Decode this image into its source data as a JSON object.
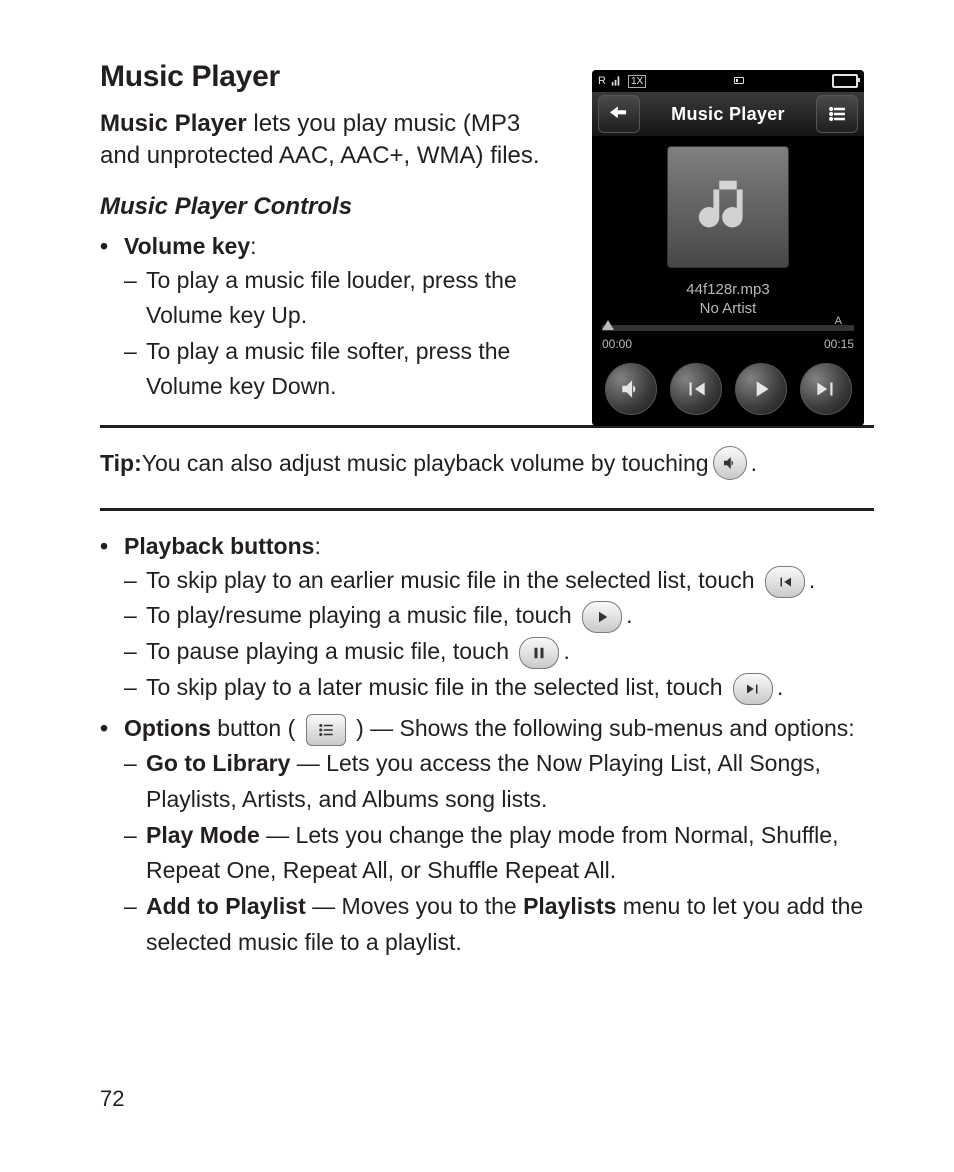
{
  "heading": "Music Player",
  "intro": {
    "bold_lead": "Music Player",
    "rest": " lets you play music (MP3 and unprotected AAC, AAC+, WMA) files."
  },
  "subheading": "Music Player Controls",
  "volume_key": {
    "label": "Volume key",
    "colon": ":",
    "items": [
      "To play a music file louder, press the Volume key Up.",
      "To play a music file softer, press the Volume key Down."
    ]
  },
  "tip": {
    "label": "Tip:",
    "text": " You can also adjust music playback volume by touching ",
    "trailing": "."
  },
  "playback": {
    "label": "Playback buttons",
    "colon": ":",
    "items": {
      "skip_prev": {
        "before": "To skip play to an earlier music file in the selected list, touch ",
        "after": "."
      },
      "play": {
        "before": "To play/resume playing a music file, touch ",
        "after": "."
      },
      "pause": {
        "before": "To pause playing a music file, touch ",
        "after": "."
      },
      "skip_next": {
        "before": "To skip play to a later music file in the selected list, touch ",
        "after": "."
      }
    }
  },
  "options": {
    "label": "Options",
    "middle": " button ( ",
    "after_icon": " ) — Shows the following sub-menus and options:",
    "items": {
      "library": {
        "bold": "Go to Library",
        "rest": " — Lets you access the Now Playing List, All Songs, Playlists, Artists, and Albums song lists."
      },
      "playmode": {
        "bold": "Play Mode",
        "rest": " — Lets you change the play mode from Normal, Shuffle, Repeat One, Repeat All, or  Shuffle Repeat All."
      },
      "playlist": {
        "bold": "Add to Playlist",
        "before_dash": " — Moves you to the ",
        "bold2": "Playlists",
        "rest": " menu to let you add the selected music file to a playlist."
      }
    }
  },
  "phone": {
    "status": {
      "signal": "R",
      "net": "1X",
      "card": "▮",
      "battery": "battery"
    },
    "title": "Music Player",
    "track_filename": "44f128r.mp3",
    "track_artist": "No Artist",
    "time_start": "00:00",
    "time_end": "00:15",
    "shuffle_mark": "A"
  },
  "page_number": "72"
}
